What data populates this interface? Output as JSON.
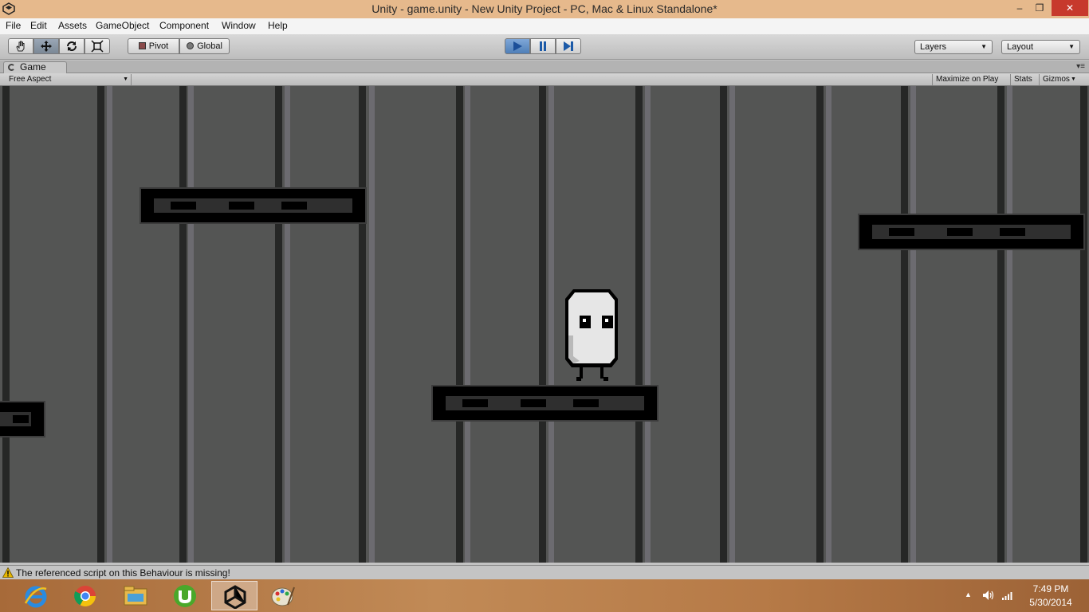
{
  "window": {
    "title": "Unity - game.unity - New Unity Project - PC, Mac & Linux Standalone*",
    "minimize": "–",
    "maximize": "❐",
    "close": "✕"
  },
  "menu": {
    "items": [
      "File",
      "Edit",
      "Assets",
      "GameObject",
      "Component",
      "Window",
      "Help"
    ]
  },
  "toolbar": {
    "pivot_label": "Pivot",
    "global_label": "Global",
    "layers_label": "Layers",
    "layout_label": "Layout",
    "play_active": true,
    "play_color": "#4f7fb8"
  },
  "game_panel": {
    "tab_label": "Game",
    "aspect_label": "Free Aspect",
    "maximize_on_play": "Maximize on Play",
    "stats": "Stats",
    "gizmos": "Gizmos"
  },
  "scene": {
    "background_color": "#545554",
    "platform_color": "#000000",
    "player_color": "#e6e6e6"
  },
  "status": {
    "message": "The referenced script on this Behaviour is missing!"
  },
  "taskbar": {
    "apps": [
      "internet-explorer-icon",
      "chrome-icon",
      "file-explorer-icon",
      "utorrent-icon",
      "unity-icon",
      "paint-icon"
    ],
    "time": "7:49 PM",
    "date": "5/30/2014"
  }
}
